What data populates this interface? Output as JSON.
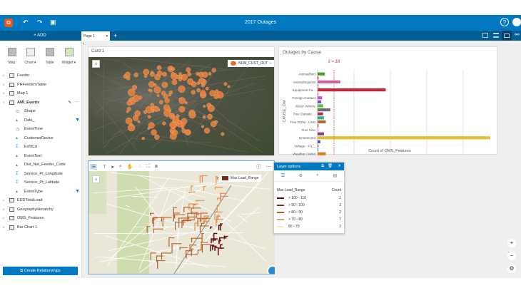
{
  "app": {
    "title": "2017 Outages",
    "accent": "#0079c1",
    "logo_icon": "insights-logo-icon"
  },
  "toolbar": {
    "undo_icon": "undo-icon",
    "redo_icon": "redo-icon",
    "save_icon": "save-icon",
    "help_icon": "help-icon"
  },
  "pages": {
    "add_label": "+ ADD",
    "tabs": [
      {
        "label": "Page 1"
      }
    ],
    "add_page": "+"
  },
  "sidebar": {
    "widget_tools": [
      {
        "label": "Map"
      },
      {
        "label": "Chart ▾"
      },
      {
        "label": "Table"
      },
      {
        "label": "Widget ▾"
      }
    ],
    "datasets": [
      {
        "label": "Feeder",
        "expanded": false
      },
      {
        "label": "PHFeedersTable",
        "expanded": false
      },
      {
        "label": "Map 1",
        "expanded": false
      },
      {
        "label": "AMI_Events",
        "expanded": true
      }
    ],
    "fields": [
      {
        "label": "Shape",
        "icon": "location-icon",
        "filtered": false
      },
      {
        "label": "Date_",
        "icon": "string-icon",
        "filtered": true
      },
      {
        "label": "EventTime",
        "icon": "clock-icon",
        "filtered": false
      },
      {
        "label": "CustomerDevice",
        "icon": "string-icon",
        "filtered": false
      },
      {
        "label": "EvntCd",
        "icon": "sigma-icon",
        "filtered": false
      },
      {
        "label": "EventText",
        "icon": "string-icon",
        "filtered": false
      },
      {
        "label": "Dist_Net_Feeder_Code",
        "icon": "string-icon",
        "filtered": false
      },
      {
        "label": "Service_Pt_Longitude",
        "icon": "sigma-icon",
        "filtered": false
      },
      {
        "label": "Service_Pt_Latitude",
        "icon": "sigma-icon",
        "filtered": false
      },
      {
        "label": "EventType",
        "icon": "string-icon",
        "filtered": true
      }
    ],
    "datasets_after": [
      {
        "label": "EDDTotalLoad"
      },
      {
        "label": "GeographyHierarchy"
      },
      {
        "label": "OMS_Features"
      },
      {
        "label": "Bar Chart 1"
      }
    ],
    "create_relationships": "Create Relationships"
  },
  "card1": {
    "title": "Card 1",
    "legend_label": "NUM_CUST_OUT"
  },
  "map2": {
    "legend_label": "Max Load_Range"
  },
  "layer_options": {
    "title": "Layer options",
    "col_field": "Max Load_Range",
    "col_count": "Count",
    "rows": [
      {
        "label": "> 100 - 110",
        "count": "1",
        "color": "#4a0d0d"
      },
      {
        "label": "> 90 - 100",
        "count": "2",
        "color": "#7a2a1a"
      },
      {
        "label": "> 80 - 90",
        "count": "2",
        "color": "#b5602a"
      },
      {
        "label": "> 70 - 80",
        "count": "7",
        "color": "#e0a070"
      },
      {
        "label": "60 - 70",
        "count": "2",
        "color": "#f5f0b0"
      }
    ]
  },
  "chart_data": {
    "type": "bar",
    "orientation": "horizontal",
    "title": "Outages by Cause",
    "xlabel": "Count of OMS_Features",
    "ylabel": "CAUSE_OM",
    "annotation": "x̄ = 18",
    "mean": 18,
    "xlim": [
      0,
      190
    ],
    "xticks": [
      0,
      40,
      80,
      120,
      160
    ],
    "grid": true,
    "categories": [
      "Animal/Bird",
      "",
      "Animal/Squirrel",
      "",
      "Equipment Fa...",
      "",
      "Foreign Contact",
      "",
      "Motor Vehicle",
      "",
      "Tree Outside ...",
      "",
      "Tree ROW - Limb",
      "",
      "Tree Vine",
      "",
      "Unselected",
      "",
      "Voltage - F/L...",
      "",
      "Weather / Wind"
    ],
    "values": [
      8,
      1,
      25,
      1,
      75,
      1,
      5,
      4,
      6,
      14,
      6,
      7,
      9,
      1,
      1,
      7,
      190,
      3,
      1,
      1,
      9
    ],
    "colors": [
      "#4a9a30",
      "#a03030",
      "#d060a0",
      "#c080c0",
      "#c0283c",
      "#e080a0",
      "#d050d0",
      "#9040e0",
      "#40d040",
      "#707070",
      "#b03060",
      "#30b090",
      "#b07030",
      "#c04060",
      "#e0a0e0",
      "#8a3a90",
      "#e0c030",
      "#4050e0",
      "#e05050",
      "#30b0e0",
      "#e08020"
    ]
  }
}
